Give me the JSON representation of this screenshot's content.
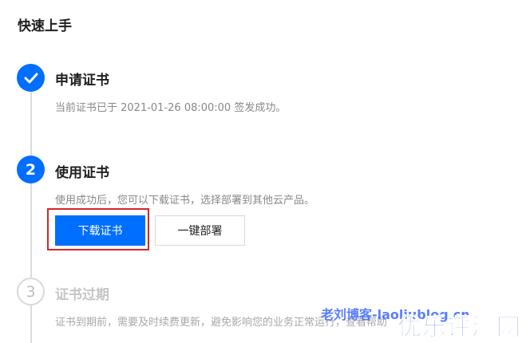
{
  "page": {
    "title": "快速上手"
  },
  "steps": [
    {
      "marker": "check",
      "title": "申请证书",
      "description": "当前证书已于 2021-01-26 08:00:00 签发成功。",
      "state": "done"
    },
    {
      "marker": "2",
      "title": "使用证书",
      "description": "使用成功后，您可以下载证书，选择部署到其他云产品。",
      "state": "active",
      "buttons": {
        "download_label": "下载证书",
        "deploy_label": "一键部署"
      }
    },
    {
      "marker": "3",
      "title": "证书过期",
      "description": "证书到期前，需要及时续费更新，避免影响您的业务正常运行，查看帮助",
      "state": "pending"
    }
  ],
  "watermark": {
    "text": "老刘博客-laoliublog.cn",
    "logo": "优乐评测网"
  },
  "colors": {
    "primary": "#006eff",
    "highlight": "#d8262c",
    "line": "#dcdcdc",
    "muted": "#888888",
    "disabled": "#c6c6c6"
  },
  "icons": {
    "step1": "check-icon"
  }
}
